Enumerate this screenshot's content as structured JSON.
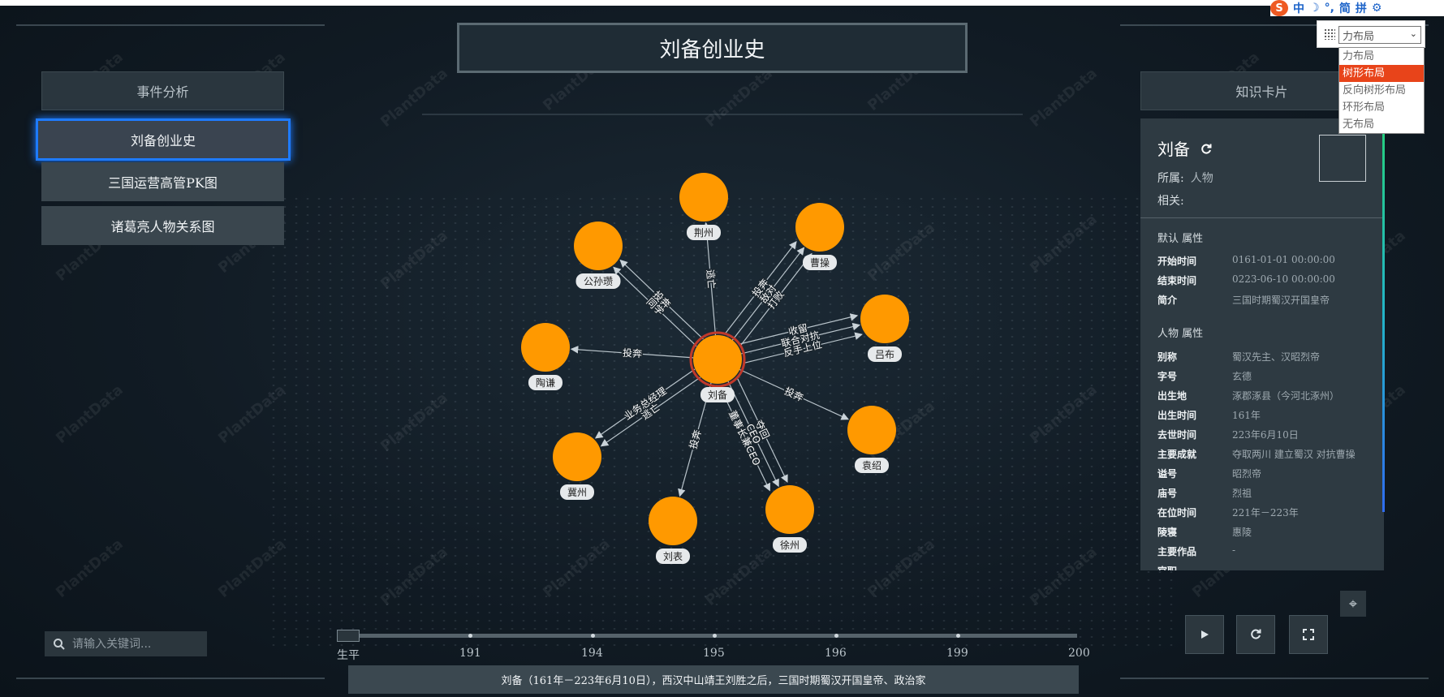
{
  "title": "刘备创业史",
  "left_panel": {
    "header": "事件分析",
    "items": [
      "刘备创业史",
      "三国运营高管PK图",
      "诸葛亮人物关系图"
    ],
    "active_index": 0
  },
  "search": {
    "placeholder": "请输入关键词..."
  },
  "watermark": "PlantData",
  "graph": {
    "center": "刘备",
    "nodes": [
      "荆州",
      "曹操",
      "吕布",
      "袁绍",
      "徐州",
      "刘表",
      "冀州",
      "陶谦",
      "公孙瓒"
    ],
    "edges": [
      {
        "target": "公孙瓒",
        "labels": [
          "同学",
          "投奔"
        ]
      },
      {
        "target": "荆州",
        "labels": [
          "逃亡"
        ]
      },
      {
        "target": "曹操",
        "labels": [
          "投奔",
          "敌对",
          "打败"
        ]
      },
      {
        "target": "吕布",
        "labels": [
          "收留",
          "联合对抗",
          "反手上位"
        ]
      },
      {
        "target": "陶谦",
        "labels": [
          "投奔"
        ]
      },
      {
        "target": "袁绍",
        "labels": [
          "投奔"
        ]
      },
      {
        "target": "冀州",
        "labels": [
          "逃亡",
          "业务总经理"
        ]
      },
      {
        "target": "刘表",
        "labels": [
          "投奔"
        ]
      },
      {
        "target": "徐州",
        "labels": [
          "夺回",
          "CEO",
          "董事长兼CEO"
        ]
      }
    ]
  },
  "timeline": {
    "ticks": [
      "生平",
      "191",
      "194",
      "195",
      "196",
      "199",
      "200"
    ],
    "caption": "刘备（161年－223年6月10日），西汉中山靖王刘胜之后，三国时期蜀汉开国皇帝、政治家"
  },
  "knowledge_card": {
    "header": "知识卡片",
    "name": "刘备",
    "category_label": "所属:",
    "category_value": "人物",
    "related_label": "相关:",
    "default_section": "默认 属性",
    "default_attrs": [
      {
        "k": "开始时间",
        "v": "0161-01-01 00:00:00"
      },
      {
        "k": "结束时间",
        "v": "0223-06-10 00:00:00"
      },
      {
        "k": "简介",
        "v": "三国时期蜀汉开国皇帝"
      }
    ],
    "person_section": "人物 属性",
    "person_attrs": [
      {
        "k": "别称",
        "v": "蜀汉先主、汉昭烈帝"
      },
      {
        "k": "字号",
        "v": "玄德"
      },
      {
        "k": "出生地",
        "v": "涿郡涿县（今河北涿州）"
      },
      {
        "k": "出生时间",
        "v": "161年"
      },
      {
        "k": "去世时间",
        "v": "223年6月10日"
      },
      {
        "k": "主要成就",
        "v": "夺取两川 建立蜀汉 对抗曹操"
      },
      {
        "k": "谥号",
        "v": "昭烈帝"
      },
      {
        "k": "庙号",
        "v": "烈祖"
      },
      {
        "k": "在位时间",
        "v": "221年－223年"
      },
      {
        "k": "陵寝",
        "v": "惠陵"
      },
      {
        "k": "主要作品",
        "v": "-"
      },
      {
        "k": "官职",
        "v": ""
      }
    ]
  },
  "layout_selector": {
    "current": "力布局",
    "options": [
      "力布局",
      "树形布局",
      "反向树形布局",
      "环形布局",
      "无布局"
    ],
    "highlighted_index": 1
  },
  "ime": {
    "items": [
      "中",
      "简",
      "拼"
    ]
  },
  "colors": {
    "accent": "#1e7bff",
    "node": "#ff9900",
    "highlight": "#e8441a"
  },
  "icons": [
    "refresh-icon",
    "play-icon",
    "reload-icon",
    "fullscreen-icon",
    "crosshair-icon",
    "search-icon",
    "grid-icon",
    "settings-icon"
  ]
}
